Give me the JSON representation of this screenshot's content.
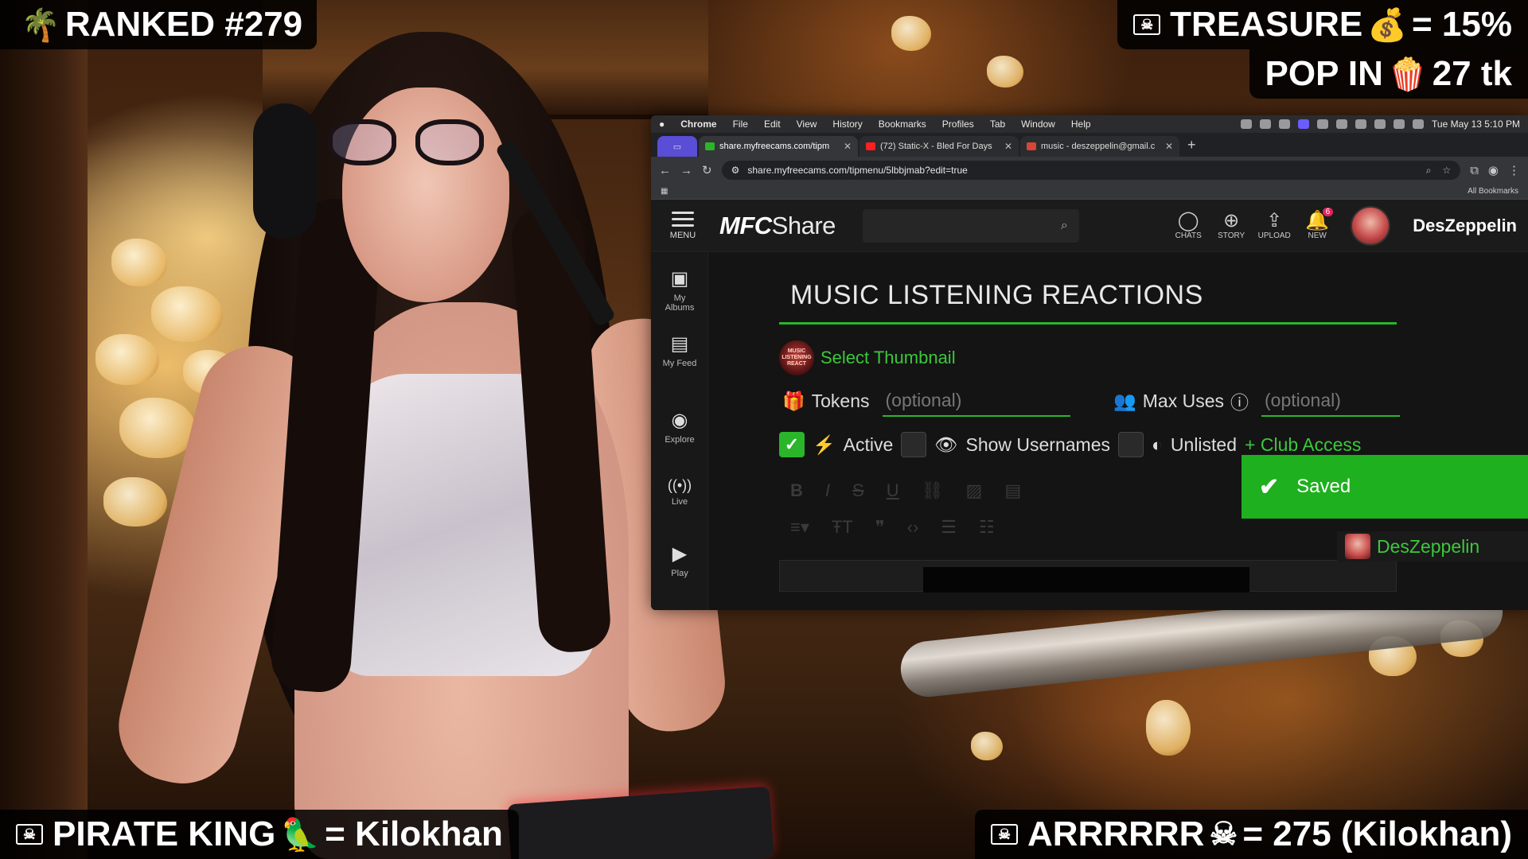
{
  "overlays": {
    "ranked": "RANKED #279",
    "treasure_label": "TREASURE",
    "treasure_value": "= 15%",
    "pop_label": "POP IN",
    "pop_value": "27 tk",
    "pirate_label": "PIRATE KING",
    "pirate_value": "= Kilokhan",
    "arr_label": "ARRRRRR",
    "arr_value": "=  275 (Kilokhan)"
  },
  "mac_menu": {
    "items": [
      "Chrome",
      "File",
      "Edit",
      "View",
      "History",
      "Bookmarks",
      "Profiles",
      "Tab",
      "Window",
      "Help"
    ],
    "clock": "Tue May 13  5:10 PM"
  },
  "browser": {
    "tabs": [
      {
        "title": "share.myfreecams.com/tipm",
        "color": "#2bb52b"
      },
      {
        "title": "(72) Static-X - Bled For Days",
        "color": "#ff2020"
      },
      {
        "title": "music - deszeppelin@gmail.c",
        "color": "#d44638"
      }
    ],
    "url": "share.myfreecams.com/tipmenu/5lbbjmab?edit=true",
    "all_bookmarks": "All Bookmarks"
  },
  "app": {
    "logo_bold": "MFC",
    "logo_light": "Share",
    "menu_label": "MENU",
    "header_icons": [
      {
        "label": "CHATS",
        "icon": "chat-bubble-icon",
        "glyph": "◯"
      },
      {
        "label": "STORY",
        "icon": "story-plus-icon",
        "glyph": "⊕"
      },
      {
        "label": "UPLOAD",
        "icon": "upload-icon",
        "glyph": "⇪"
      },
      {
        "label": "NEW",
        "icon": "bell-icon",
        "glyph": "🔔",
        "badge": "6"
      }
    ],
    "username": "DesZeppelin",
    "sidenav": [
      {
        "label": "My Albums",
        "icon": "albums-icon",
        "glyph": "▣"
      },
      {
        "label": "My Feed",
        "icon": "feed-icon",
        "glyph": "▤"
      },
      {
        "label": "Explore",
        "icon": "compass-icon",
        "glyph": "◉"
      },
      {
        "label": "Live",
        "icon": "broadcast-icon",
        "glyph": "((•))"
      },
      {
        "label": "Play",
        "icon": "play-icon",
        "glyph": "▶"
      }
    ]
  },
  "form": {
    "title": "MUSIC LISTENING REACTIONS",
    "thumb_text": "MUSIC LISTENING REACT",
    "select_thumbnail": "Select Thumbnail",
    "tokens_label": "Tokens",
    "tokens_placeholder": "(optional)",
    "max_uses_label": "Max Uses",
    "max_uses_placeholder": "(optional)",
    "active_label": "Active",
    "show_usernames_label": "Show Usernames",
    "unlisted_label": "Unlisted",
    "club_access": "+ Club Access",
    "active_checked": true,
    "show_usernames_checked": false,
    "unlisted_checked": false
  },
  "toast": {
    "text": "Saved"
  },
  "chat_dock": {
    "name": "DesZeppelin"
  },
  "colors": {
    "accent_green": "#2bb52b",
    "toast_green": "#1eb01e",
    "badge_red": "#e0245e"
  }
}
